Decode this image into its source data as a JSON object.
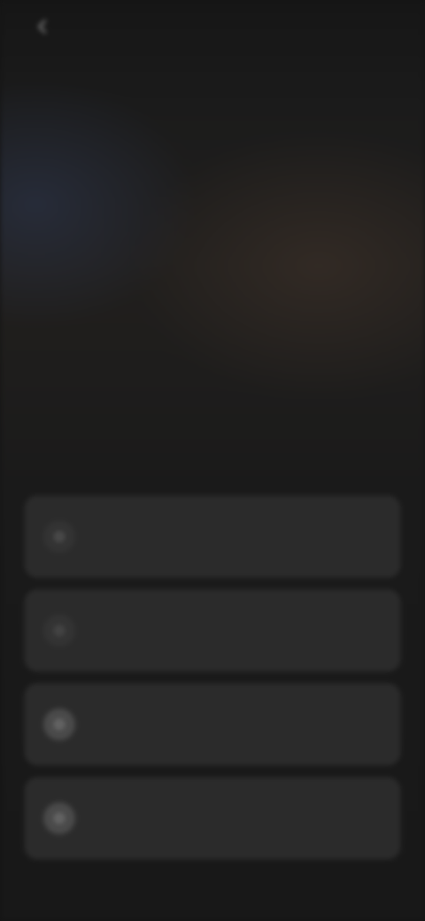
{
  "header": {
    "back_label": "",
    "title": "",
    "right_link": ""
  },
  "hero": {
    "headline": "",
    "subtext": ""
  },
  "options": [
    {
      "label": "",
      "icon": "option-icon"
    },
    {
      "label": "",
      "icon": "option-icon"
    },
    {
      "label": "",
      "icon": "option-icon"
    },
    {
      "label": "",
      "icon": "option-icon"
    }
  ],
  "colors": {
    "background": "#141414",
    "card": "#2b2b2b",
    "headline": "#f2f2f2"
  }
}
